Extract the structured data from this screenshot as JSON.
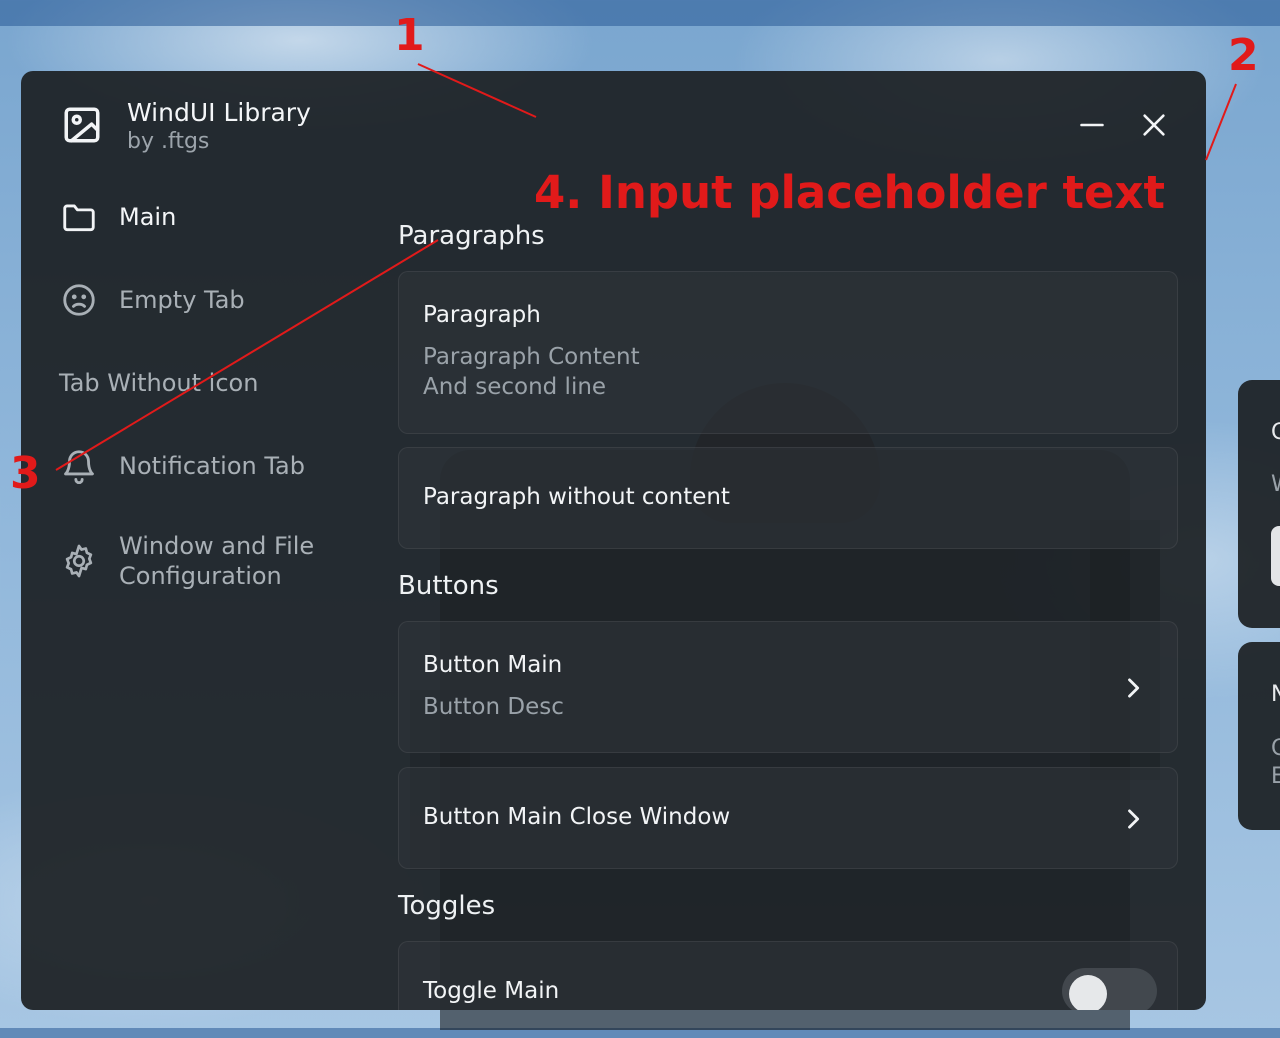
{
  "window": {
    "title": "WindUI Library",
    "author": "by .ftgs",
    "icon": "image-icon",
    "controls": {
      "minimize_icon": "minus-icon",
      "close_icon": "close-icon"
    }
  },
  "sidebar": {
    "tabs": [
      {
        "label": "Main",
        "icon": "folder-icon",
        "active": true
      },
      {
        "label": "Empty Tab",
        "icon": "sad-face-icon",
        "active": false
      },
      {
        "label": "Tab Without icon",
        "icon": "",
        "active": false
      },
      {
        "label": "Notification Tab",
        "icon": "bell-icon",
        "active": false
      },
      {
        "label": "Window and File\nConfiguration",
        "icon": "gear-icon",
        "active": false
      }
    ]
  },
  "content": {
    "sections": {
      "paragraphs": "Paragraphs",
      "buttons": "Buttons",
      "toggles": "Toggles"
    },
    "paragraph1": {
      "title": "Paragraph",
      "desc": "Paragraph Content\nAnd second line"
    },
    "paragraph2": {
      "title": "Paragraph without content"
    },
    "button1": {
      "title": "Button Main",
      "desc": "Button Desc",
      "icon": "chevron-right-icon"
    },
    "button2": {
      "title": "Button Main Close Window",
      "icon": "chevron-right-icon"
    },
    "toggle1": {
      "title": "Toggle Main",
      "value": false
    }
  },
  "notifications": {
    "card1_letters": [
      "C",
      "W"
    ],
    "card2_letters": [
      "N",
      "C",
      "E"
    ]
  },
  "annotations": {
    "a1": "1",
    "a2": "2",
    "a3": "3",
    "a4": "4. Input placeholder text"
  },
  "colors": {
    "window_bg": "#1c2024",
    "annotation": "#e11a1a",
    "text_primary": "#f2f4f6",
    "text_secondary": "#9aa2a9"
  }
}
